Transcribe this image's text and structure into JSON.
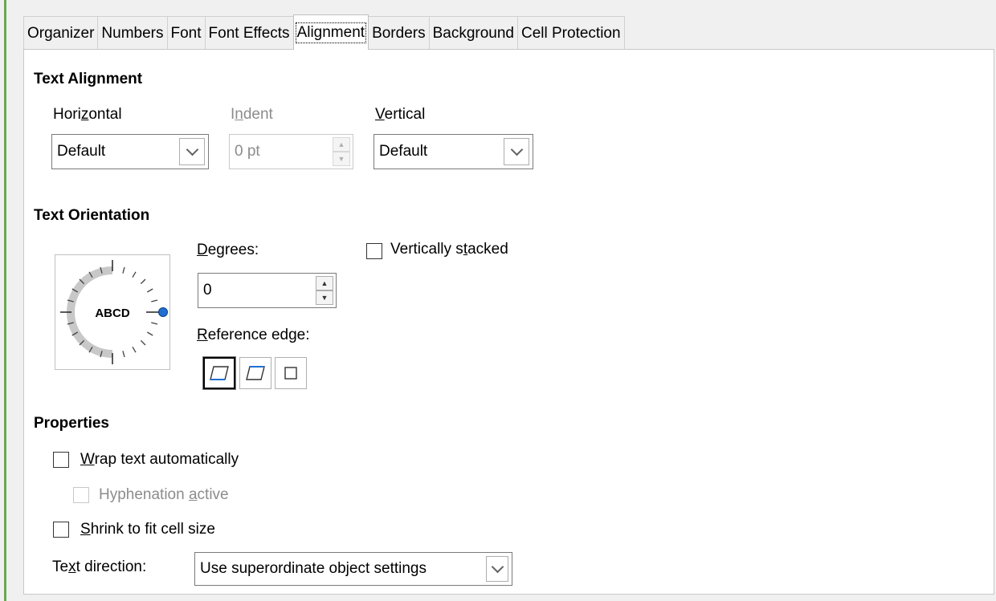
{
  "tabs": [
    {
      "label": "Organizer"
    },
    {
      "label": "Numbers"
    },
    {
      "label": "Font"
    },
    {
      "label": "Font Effects"
    },
    {
      "label": "Alignment",
      "active": true
    },
    {
      "label": "Borders"
    },
    {
      "label": "Background"
    },
    {
      "label": "Cell Protection"
    }
  ],
  "text_alignment": {
    "heading": "Text Alignment",
    "horizontal": {
      "label_pre": "Hori",
      "label_u": "z",
      "label_post": "ontal",
      "value": "Default"
    },
    "indent": {
      "label_pre": "I",
      "label_u": "n",
      "label_post": "dent",
      "value": "0 pt"
    },
    "vertical": {
      "label_pre": "",
      "label_u": "V",
      "label_post": "ertical",
      "value": "Default"
    }
  },
  "text_orientation": {
    "heading": "Text Orientation",
    "dial_text": "ABCD",
    "degrees": {
      "label_u": "D",
      "label_post": "egrees:",
      "value": "0"
    },
    "reference_edge": {
      "label_u": "R",
      "label_post": "eference edge:"
    },
    "vertically_stacked": {
      "label_pre": "Vertically s",
      "label_u": "t",
      "label_post": "acked",
      "checked": false
    }
  },
  "properties": {
    "heading": "Properties",
    "wrap_text": {
      "label_u": "W",
      "label_post": "rap text automatically",
      "checked": false
    },
    "hyphenation": {
      "label_pre": "Hyphenation ",
      "label_u": "a",
      "label_post": "ctive",
      "checked": false
    },
    "shrink": {
      "label_u": "S",
      "label_post": "hrink to fit cell size",
      "checked": false
    },
    "text_direction": {
      "label_pre": "Te",
      "label_u": "x",
      "label_post": "t direction:",
      "value": "Use superordinate object settings"
    }
  },
  "colors": {
    "accent_line": "#6aa84f",
    "dial_marker": "#1f6fd1"
  }
}
